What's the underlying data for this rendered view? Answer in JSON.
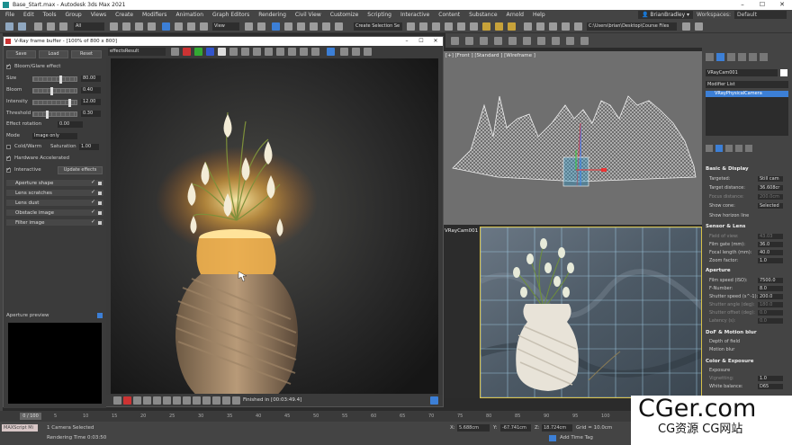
{
  "window": {
    "title": "Base_Start.max - Autodesk 3ds Max 2021"
  },
  "menu": [
    "File",
    "Edit",
    "Tools",
    "Group",
    "Views",
    "Create",
    "Modifiers",
    "Animation",
    "Graph Editors",
    "Rendering",
    "Civil View",
    "Customize",
    "Scripting",
    "Interactive",
    "Content",
    "Substance",
    "Arnold",
    "Help"
  ],
  "user": {
    "name": "BrianBradley",
    "workspaces_label": "Workspaces:",
    "workspace": "Default"
  },
  "toolbar": {
    "filter": "All",
    "view": "View",
    "selection_set": "Create Selection Se",
    "path": "C:\\Users\\brian\\Desktop\\Course Files"
  },
  "vfb": {
    "title": "V-Ray frame buffer - [100% of 800 x 800]",
    "save": "Save",
    "load": "Load",
    "reset": "Reset",
    "bloom_glare": "Bloom/Glare effect",
    "params": [
      {
        "label": "Size",
        "value": "80.00",
        "pos": 0.62
      },
      {
        "label": "Bloom",
        "value": "0.40",
        "pos": 0.4
      },
      {
        "label": "Intensity",
        "value": "12.00",
        "pos": 0.82
      },
      {
        "label": "Threshold",
        "value": "0.30",
        "pos": 0.3
      }
    ],
    "effect_rotation_label": "Effect rotation",
    "effect_rotation": "0.00",
    "mode_label": "Mode",
    "mode": "Image only",
    "cold_warm": "Cold/Warm",
    "saturation_label": "Saturation",
    "saturation": "1.00",
    "hw_accel": "Hardware Accelerated",
    "interactive": "Interactive",
    "update_effects": "Update effects",
    "layers": [
      "Aperture shape",
      "Lens scratches",
      "Lens dust",
      "Obstacle image",
      "Filter image"
    ],
    "aperture_preview": "Aperture preview",
    "channel": "effectsResult",
    "status": "Finished in [00:03:49.4]"
  },
  "viewports": {
    "top": "[+] [Front ] [Standard ] [Wireframe ]",
    "camera": "VRayCam001 ] [Standard ] [Default Shading ]"
  },
  "rpanel": {
    "object_name": "VRayCam001",
    "modifier_list": "Modifier List",
    "stack_item": "VRayPhysicalCamera",
    "basic_display": "Basic & Display",
    "targeted": "Targeted:",
    "targeted_value": "Still cam",
    "target_distance_label": "Target distance:",
    "target_distance": "36.608cr",
    "focus_distance_label": "Focus distance:",
    "focus_distance": "200.0cm",
    "show_cone_label": "Show cone:",
    "show_cone": "Selected",
    "show_horizon": "Show horizon line",
    "sensor_lens": "Sensor & Lens",
    "sensor": [
      {
        "l": "Field of view:",
        "v": "43.03",
        "dim": true
      },
      {
        "l": "Film gate (mm):",
        "v": "36.0"
      },
      {
        "l": "Focal length (mm):",
        "v": "40.0"
      },
      {
        "l": "Zoom factor:",
        "v": "1.0"
      }
    ],
    "aperture": "Aperture",
    "aperture_rows": [
      {
        "l": "Film speed (ISO):",
        "v": "7500.0"
      },
      {
        "l": "F-Number:",
        "v": "8.0"
      },
      {
        "l": "Shutter speed (s^-1):",
        "v": "200.0"
      },
      {
        "l": "Shutter angle (deg):",
        "v": "180.0",
        "dim": true
      },
      {
        "l": "Shutter offset (deg):",
        "v": "0.0",
        "dim": true
      },
      {
        "l": "Latency (s):",
        "v": "0.0",
        "dim": true
      }
    ],
    "dof_motion": "DoF & Motion blur",
    "depth_of_field": "Depth of field",
    "motion_blur": "Motion blur",
    "color_exposure": "Color & Exposure",
    "exposure": "Exposure",
    "vignetting_label": "Vignetting:",
    "vignetting": "1.0",
    "white_balance_label": "White balance:",
    "white_balance": "D65"
  },
  "timeline": {
    "frame": "0 / 100",
    "ticks": [
      "5",
      "10",
      "15",
      "20",
      "25",
      "30",
      "35",
      "40",
      "45",
      "50",
      "55",
      "60",
      "65",
      "70",
      "75",
      "80",
      "85",
      "90",
      "95",
      "100"
    ]
  },
  "status": {
    "maxscript": "MAXScript Mi",
    "selected": "1 Camera Selected",
    "render_time": "Rendering Time 0:03:50",
    "x_label": "X:",
    "x": "5.688cm",
    "y_label": "Y:",
    "y": "-67.741cm",
    "z_label": "Z:",
    "z": "18.724cm",
    "grid": "Grid = 10.0cm",
    "add_time_tag": "Add Time Tag"
  },
  "watermark": {
    "line1": "CGer.com",
    "line2": "CG资源 CG网站"
  }
}
